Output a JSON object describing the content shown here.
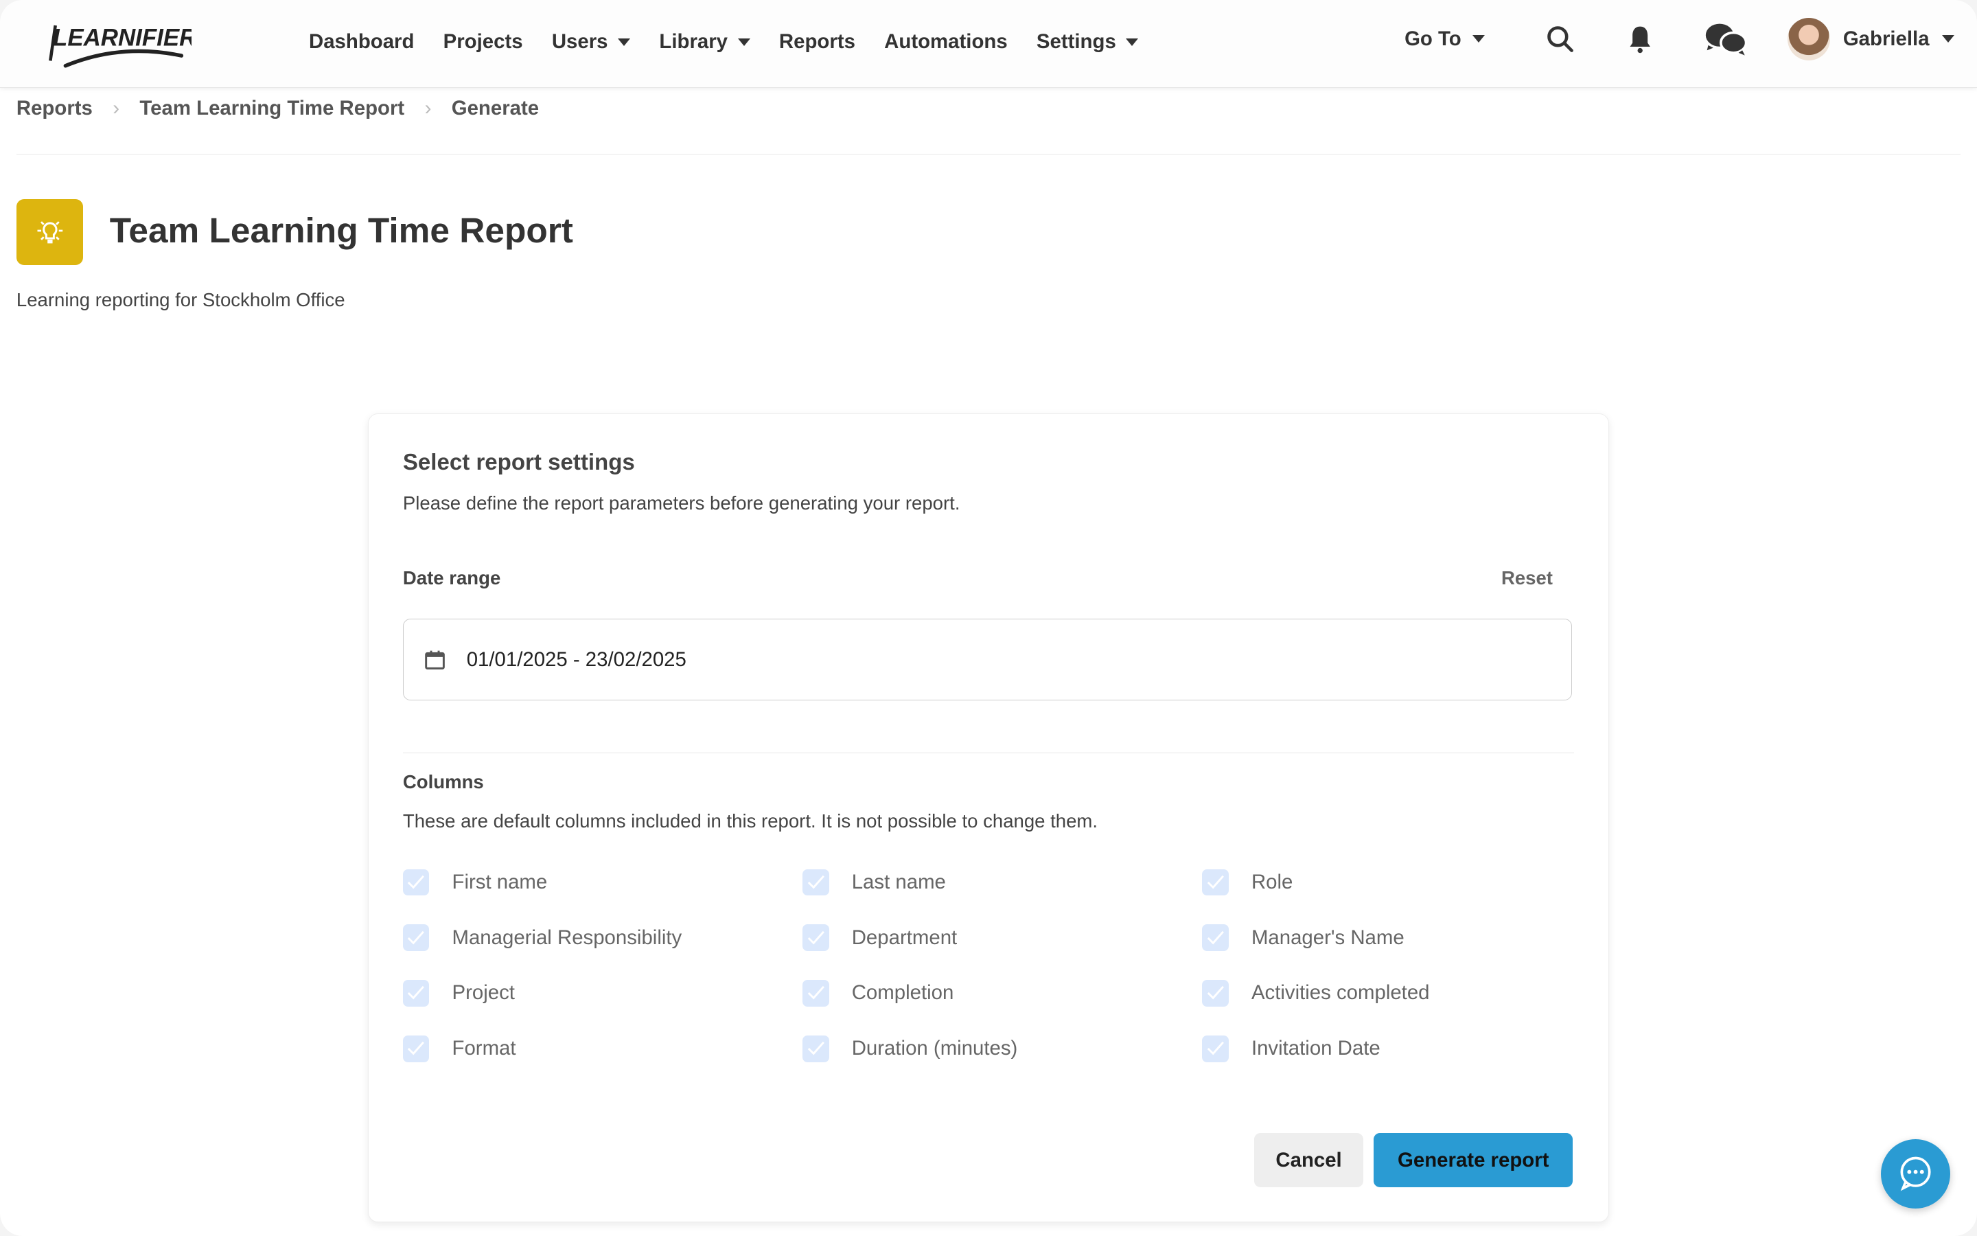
{
  "brand": {
    "logo": "LEARNIFIER",
    "accent": "#ddb50f",
    "primary": "#2a9bd3"
  },
  "nav": {
    "items": [
      {
        "label": "Dashboard"
      },
      {
        "label": "Projects"
      },
      {
        "label": "Users",
        "dropdown": true
      },
      {
        "label": "Library",
        "dropdown": true
      },
      {
        "label": "Reports"
      },
      {
        "label": "Automations"
      },
      {
        "label": "Settings",
        "dropdown": true
      }
    ],
    "goto": "Go To",
    "user": "Gabriella"
  },
  "breadcrumb": [
    "Reports",
    "Team Learning Time Report",
    "Generate"
  ],
  "page": {
    "title": "Team Learning Time Report",
    "subtitle": "Learning reporting for Stockholm Office",
    "icon": "lightbulb-icon"
  },
  "card": {
    "title": "Select report settings",
    "description": "Please define the report parameters before generating your report.",
    "date_label": "Date range",
    "reset": "Reset",
    "date_value": "01/01/2025 - 23/02/2025",
    "columns_label": "Columns",
    "columns_description": "These are default columns included in this report. It is not possible to change them.",
    "columns": [
      "First name",
      "Last name",
      "Role",
      "Managerial Responsibility",
      "Department",
      "Manager's Name",
      "Project",
      "Completion",
      "Activities completed",
      "Format",
      "Duration (minutes)",
      "Invitation Date"
    ],
    "cancel": "Cancel",
    "generate": "Generate report"
  }
}
